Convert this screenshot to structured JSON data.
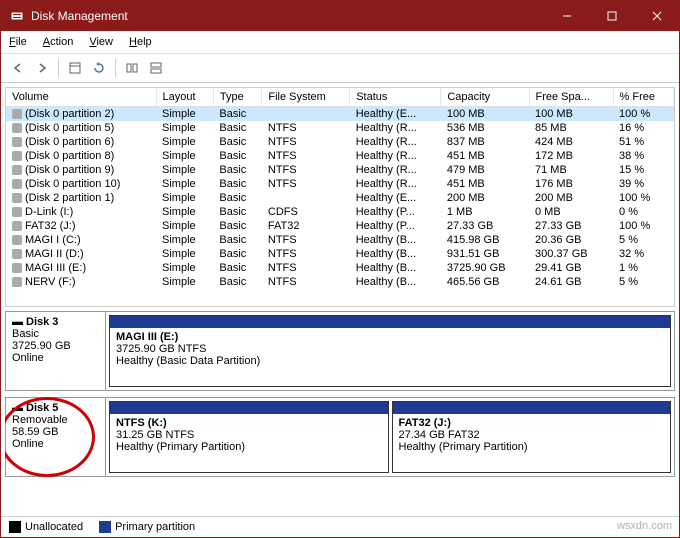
{
  "window": {
    "title": "Disk Management"
  },
  "menubar": [
    "File",
    "Action",
    "View",
    "Help"
  ],
  "columns": [
    "Volume",
    "Layout",
    "Type",
    "File System",
    "Status",
    "Capacity",
    "Free Spa...",
    "% Free"
  ],
  "volumes": [
    {
      "name": "(Disk 0 partition 2)",
      "layout": "Simple",
      "type": "Basic",
      "fs": "",
      "status": "Healthy (E...",
      "cap": "100 MB",
      "free": "100 MB",
      "pct": "100 %",
      "sel": true
    },
    {
      "name": "(Disk 0 partition 5)",
      "layout": "Simple",
      "type": "Basic",
      "fs": "NTFS",
      "status": "Healthy (R...",
      "cap": "536 MB",
      "free": "85 MB",
      "pct": "16 %"
    },
    {
      "name": "(Disk 0 partition 6)",
      "layout": "Simple",
      "type": "Basic",
      "fs": "NTFS",
      "status": "Healthy (R...",
      "cap": "837 MB",
      "free": "424 MB",
      "pct": "51 %"
    },
    {
      "name": "(Disk 0 partition 8)",
      "layout": "Simple",
      "type": "Basic",
      "fs": "NTFS",
      "status": "Healthy (R...",
      "cap": "451 MB",
      "free": "172 MB",
      "pct": "38 %"
    },
    {
      "name": "(Disk 0 partition 9)",
      "layout": "Simple",
      "type": "Basic",
      "fs": "NTFS",
      "status": "Healthy (R...",
      "cap": "479 MB",
      "free": "71 MB",
      "pct": "15 %"
    },
    {
      "name": "(Disk 0 partition 10)",
      "layout": "Simple",
      "type": "Basic",
      "fs": "NTFS",
      "status": "Healthy (R...",
      "cap": "451 MB",
      "free": "176 MB",
      "pct": "39 %"
    },
    {
      "name": "(Disk 2 partition 1)",
      "layout": "Simple",
      "type": "Basic",
      "fs": "",
      "status": "Healthy (E...",
      "cap": "200 MB",
      "free": "200 MB",
      "pct": "100 %"
    },
    {
      "name": "D-Link (I:)",
      "layout": "Simple",
      "type": "Basic",
      "fs": "CDFS",
      "status": "Healthy (P...",
      "cap": "1 MB",
      "free": "0 MB",
      "pct": "0 %"
    },
    {
      "name": "FAT32 (J:)",
      "layout": "Simple",
      "type": "Basic",
      "fs": "FAT32",
      "status": "Healthy (P...",
      "cap": "27.33 GB",
      "free": "27.33 GB",
      "pct": "100 %"
    },
    {
      "name": "MAGI I (C:)",
      "layout": "Simple",
      "type": "Basic",
      "fs": "NTFS",
      "status": "Healthy (B...",
      "cap": "415.98 GB",
      "free": "20.36 GB",
      "pct": "5 %"
    },
    {
      "name": "MAGI II (D:)",
      "layout": "Simple",
      "type": "Basic",
      "fs": "NTFS",
      "status": "Healthy (B...",
      "cap": "931.51 GB",
      "free": "300.37 GB",
      "pct": "32 %"
    },
    {
      "name": "MAGI III (E:)",
      "layout": "Simple",
      "type": "Basic",
      "fs": "NTFS",
      "status": "Healthy (B...",
      "cap": "3725.90 GB",
      "free": "29.41 GB",
      "pct": "1 %"
    },
    {
      "name": "NERV (F:)",
      "layout": "Simple",
      "type": "Basic",
      "fs": "NTFS",
      "status": "Healthy (B...",
      "cap": "465.56 GB",
      "free": "24.61 GB",
      "pct": "5 %"
    }
  ],
  "disks": [
    {
      "name": "Disk 3",
      "type": "Basic",
      "size": "3725.90 GB",
      "status": "Online",
      "parts": [
        {
          "title": "MAGI III  (E:)",
          "line2": "3725.90 GB NTFS",
          "line3": "Healthy (Basic Data Partition)"
        }
      ]
    },
    {
      "name": "Disk 5",
      "type": "Removable",
      "size": "58.59 GB",
      "status": "Online",
      "circled": true,
      "parts": [
        {
          "title": "NTFS  (K:)",
          "line2": "31.25 GB NTFS",
          "line3": "Healthy (Primary Partition)"
        },
        {
          "title": "FAT32  (J:)",
          "line2": "27.34 GB FAT32",
          "line3": "Healthy (Primary Partition)"
        }
      ]
    }
  ],
  "legend": [
    {
      "label": "Unallocated",
      "color": "#000000"
    },
    {
      "label": "Primary partition",
      "color": "#1f3a93"
    }
  ],
  "watermark": "wsxdn.com"
}
